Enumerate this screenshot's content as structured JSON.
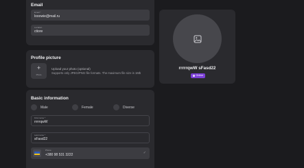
{
  "email_section": {
    "title": "Email",
    "email": {
      "label": "Email *",
      "value": "looowie@mail.ru"
    },
    "location": {
      "label": "Location",
      "value": "ctiore"
    }
  },
  "profile_picture": {
    "title": "Profile picture",
    "button_label": "Photo",
    "upload_title": "Upload your photo (optional)",
    "upload_hint": "Supports only JPEG/PNG file formats. The maximum file size is 1Mb"
  },
  "basic_information": {
    "title": "Basic information",
    "gender_options": [
      "Male",
      "Female",
      "Diverse"
    ],
    "first_name": {
      "label": "First name *",
      "value": "rrrrrqwW"
    },
    "last_name": {
      "label": "Last name *",
      "value": "sFasd22"
    },
    "phone": {
      "label": "Phone",
      "value": "+380 98 531 3222"
    }
  },
  "profile_preview": {
    "name": "rrrrrqwW sFasd22",
    "status": "Online",
    "status_color": "#7b3fd6"
  },
  "icons": {
    "upload": "plus-icon",
    "avatar": "image-icon",
    "phone_flag": "ukraine-flag-icon",
    "phone_status": "check-icon"
  }
}
